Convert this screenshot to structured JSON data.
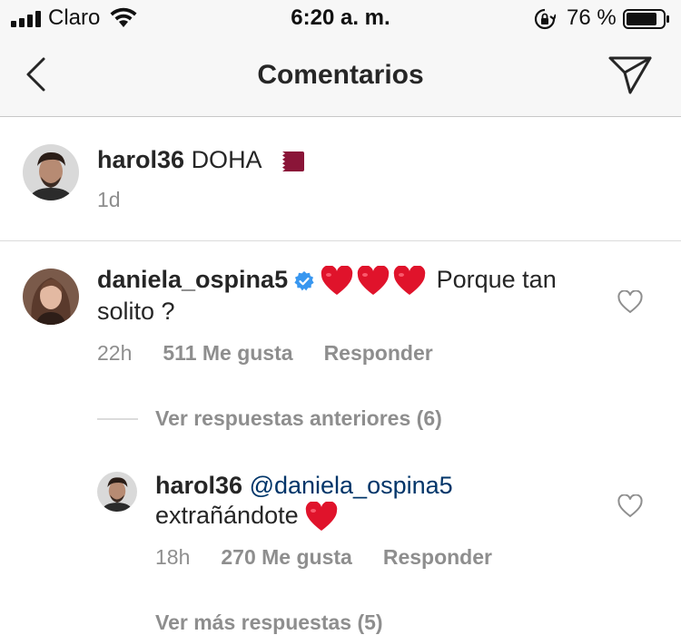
{
  "status_bar": {
    "carrier": "Claro",
    "time": "6:20 a. m.",
    "battery_pct": "76 %"
  },
  "nav": {
    "title": "Comentarios"
  },
  "caption": {
    "username": "harol36",
    "text": "DOHA",
    "time": "1d"
  },
  "comment": {
    "username": "daniela_ospina5",
    "text_after_hearts": "Porque tan",
    "text_second_line": "solito ?",
    "time": "22h",
    "likes": "511 Me gusta",
    "reply_label": "Responder"
  },
  "replies_toggle": {
    "label": "Ver respuestas anteriores (6)"
  },
  "reply": {
    "username": "harol36",
    "mention": "@daniela_ospina5",
    "text": "extrañándote",
    "time": "18h",
    "likes": "270 Me gusta",
    "reply_label": "Responder"
  },
  "more_replies": {
    "label": "Ver más respuestas (5)"
  },
  "colors": {
    "accent_mention": "#003569",
    "verified_blue": "#3897f0",
    "heart_red": "#e0132b",
    "muted_text": "#8e8e8e"
  },
  "icons": [
    "signal-icon",
    "wifi-icon",
    "rotation-lock-icon",
    "battery-icon",
    "back-chevron-icon",
    "direct-send-icon",
    "qatar-flag-icon",
    "verified-badge-icon",
    "red-heart-emoji",
    "like-heart-outline-icon"
  ]
}
